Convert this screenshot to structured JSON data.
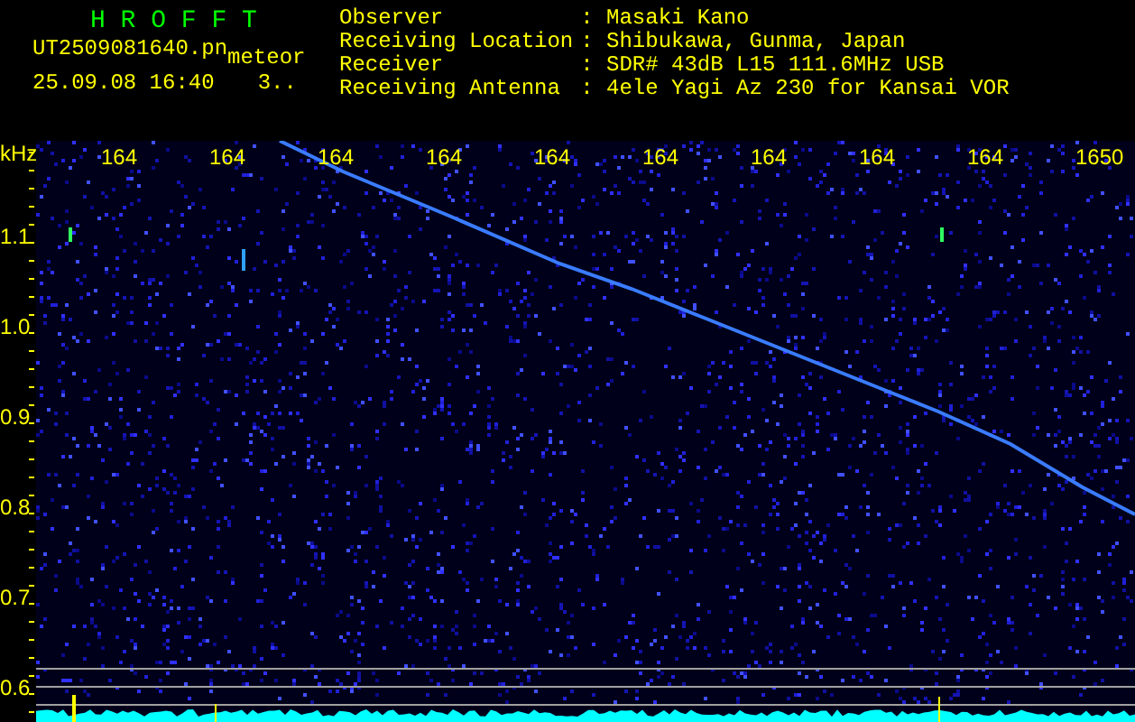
{
  "header": {
    "title": "H R O F F T",
    "filename": "UT2509081640.pn",
    "mode": "meteor",
    "datetime": "25.09.08 16:40",
    "counter": "3..",
    "info": [
      {
        "label": "Observer",
        "value": ": Masaki Kano"
      },
      {
        "label": "Receiving Location",
        "value": ": Shibukawa, Gunma, Japan"
      },
      {
        "label": "Receiver",
        "value": ": SDR# 43dB L15 111.6MHz USB"
      },
      {
        "label": "Receiving Antenna",
        "value": ": 4ele Yagi Az 230 for Kansai VOR"
      }
    ]
  },
  "plot": {
    "unit": "kHz",
    "y_labels": [
      "1.1",
      "1.0",
      "0.9",
      "0.8",
      "0.7",
      "0.6"
    ],
    "x_labels": [
      "164",
      "164",
      "164",
      "164",
      "164",
      "164",
      "164",
      "164",
      "164",
      "1650"
    ]
  }
}
